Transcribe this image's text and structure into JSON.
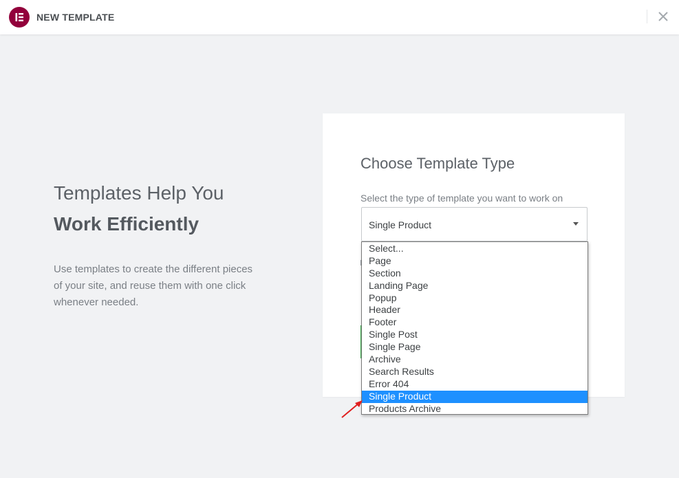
{
  "header": {
    "title": "NEW TEMPLATE",
    "logo_icon": "elementor-logo-icon",
    "close_icon": "close-icon",
    "brand_color": "#92003b"
  },
  "intro": {
    "title_line1": "Templates Help You",
    "title_line2": "Work Efficiently",
    "description": "Use templates to create the different pieces of your site, and reuse them with one click whenever needed."
  },
  "form": {
    "title": "Choose Template Type",
    "label": "Select the type of template you want to work on",
    "selected_value": "Single Product",
    "options": [
      "Select...",
      "Page",
      "Section",
      "Landing Page",
      "Popup",
      "Header",
      "Footer",
      "Single Post",
      "Single Page",
      "Archive",
      "Search Results",
      "Error 404",
      "Single Product",
      "Products Archive"
    ],
    "highlight_color": "#1e90ff"
  },
  "annotation": {
    "arrow_icon": "red-arrow-icon",
    "arrow_color": "#e02020"
  }
}
